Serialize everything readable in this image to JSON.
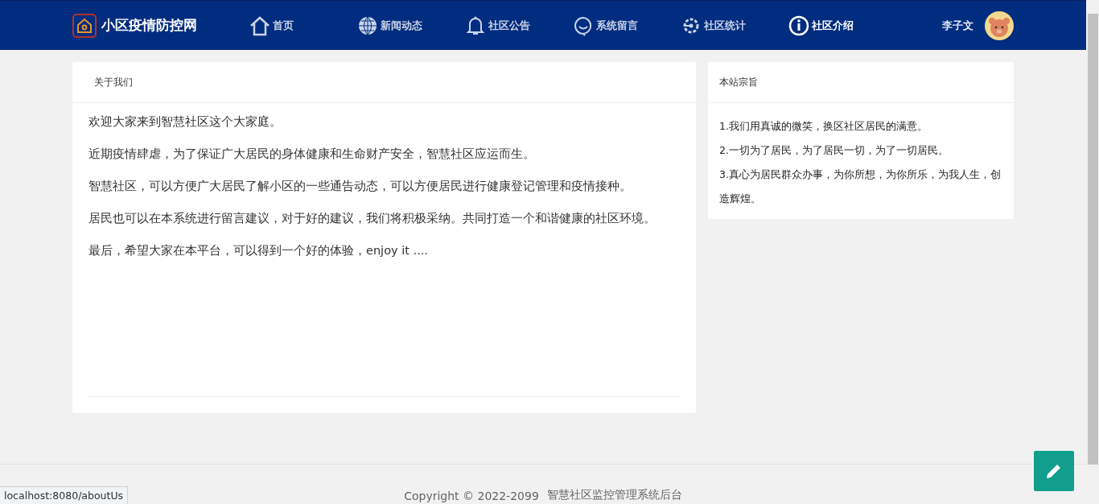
{
  "brand": {
    "title": "小区疫情防控网"
  },
  "nav": [
    {
      "label": "首页",
      "selected": false
    },
    {
      "label": "新闻动态",
      "selected": false
    },
    {
      "label": "社区公告",
      "selected": false
    },
    {
      "label": "系统留言",
      "selected": false
    },
    {
      "label": "社区统计",
      "selected": false
    },
    {
      "label": "社区介绍",
      "selected": true
    }
  ],
  "user": {
    "name": "李子文"
  },
  "about": {
    "title": "关于我们",
    "paragraphs": [
      "欢迎大家来到智慧社区这个大家庭。",
      "近期疫情肆虐，为了保证广大居民的身体健康和生命财产安全，智慧社区应运而生。",
      "智慧社区，可以方便广大居民了解小区的一些通告动态，可以方便居民进行健康登记管理和疫情接种。",
      "居民也可以在本系统进行留言建议，对于好的建议，我们将积极采纳。共同打造一个和谐健康的社区环境。",
      "最后，希望大家在本平台，可以得到一个好的体验，enjoy it ...."
    ]
  },
  "purpose": {
    "title": "本站宗旨",
    "items": [
      "1.我们用真诚的微笑，换区社区居民的满意。",
      "2.一切为了居民，为了居民一切，为了一切居民。",
      "3.真心为居民群众办事，为你所想，为你所乐，为我人生，创造辉煌。"
    ]
  },
  "footer": {
    "copyright": "Copyright © 2022-2099",
    "system": "智慧社区监控管理系统后台"
  },
  "status_url": "localhost:8080/aboutUs"
}
